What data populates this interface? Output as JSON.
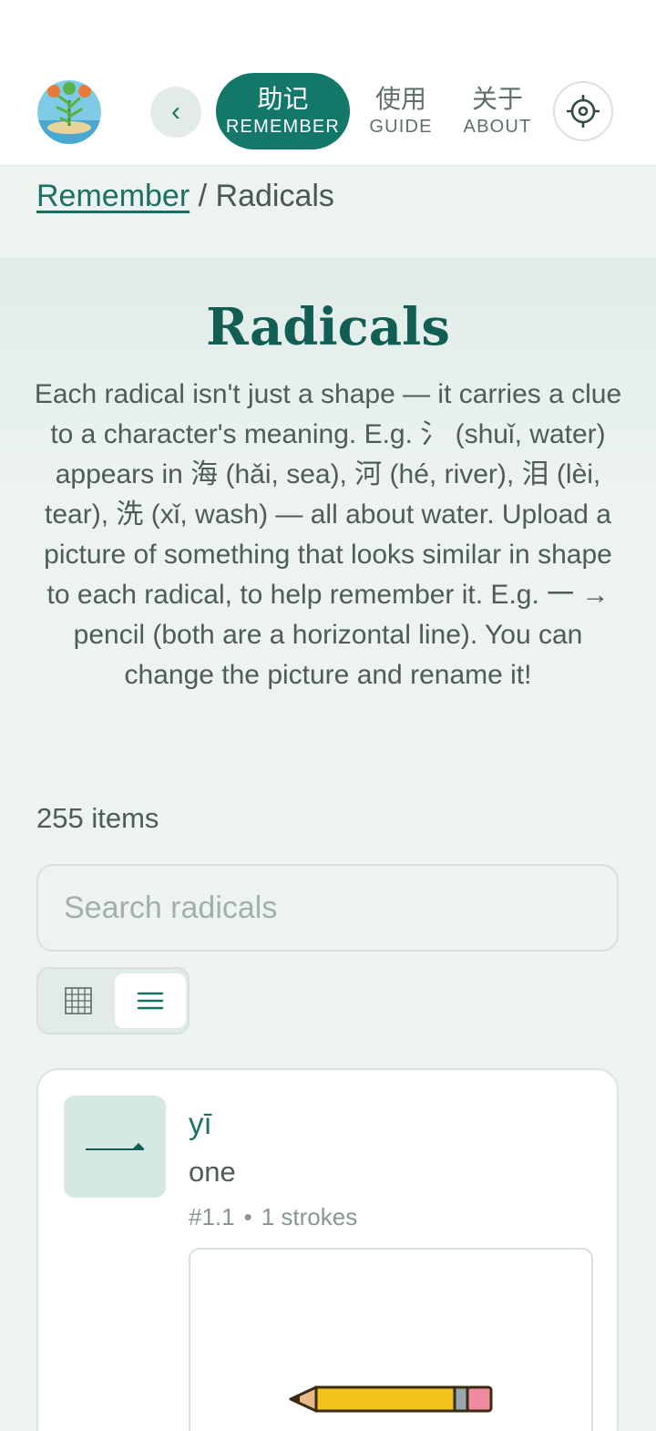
{
  "header": {
    "logo_label": "语言岛",
    "back_glyph": "‹",
    "nav": [
      {
        "zh": "助记",
        "en": "REMEMBER",
        "active": true
      },
      {
        "zh": "使用",
        "en": "GUIDE",
        "active": false
      },
      {
        "zh": "关于",
        "en": "ABOUT",
        "active": false
      }
    ],
    "settings_icon": "gear-icon"
  },
  "breadcrumb": {
    "parent": "Remember",
    "separator": " / ",
    "current": "Radicals"
  },
  "page": {
    "title": "Radicals",
    "intro": "Each radical isn't just a shape — it carries a clue to a character's meaning. E.g. 氵 (shuǐ, water) appears in 海 (hǎi, sea), 河 (hé, river), 泪 (lèi, tear), 洗 (xǐ, wash) — all about water. Upload a picture of something that looks similar in shape to each radical, to help remember it. E.g. 一 → pencil (both are a horizontal line). You can change the picture and rename it!",
    "count": "255 items"
  },
  "search": {
    "placeholder": "Search radicals",
    "value": ""
  },
  "view_toggle": {
    "options": [
      "grid-icon",
      "list-icon"
    ],
    "selected": "list"
  },
  "colors": {
    "accent": "#13786a",
    "title": "#135e54",
    "background": "#edf3f0"
  },
  "items": [
    {
      "glyph": "一",
      "pinyin": "yī",
      "meaning": "one",
      "number": "#1.1",
      "dot": "•",
      "strokes": "1 strokes",
      "picture": "pencil"
    }
  ]
}
